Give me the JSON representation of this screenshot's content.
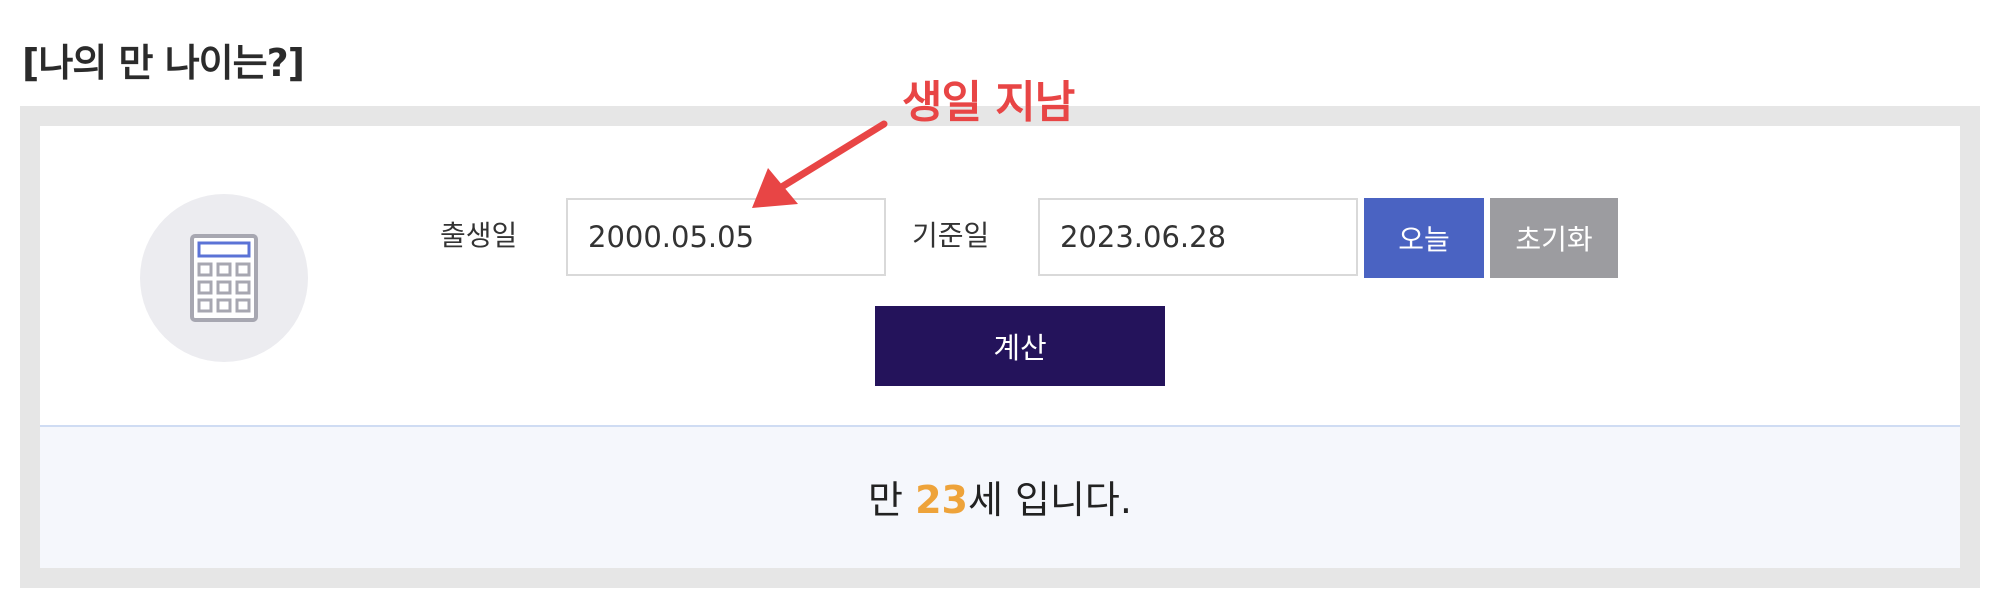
{
  "page": {
    "title": "[나의 만 나이는?]"
  },
  "form": {
    "birth_label": "출생일",
    "birth_value": "2000.05.05",
    "ref_label": "기준일",
    "ref_value": "2023.06.28",
    "today_button": "오늘",
    "reset_button": "초기화",
    "calc_button": "계산"
  },
  "result": {
    "prefix": "만 ",
    "age": "23",
    "suffix": "세 입니다."
  },
  "annotation": {
    "text": "생일 지남"
  },
  "colors": {
    "today_button": "#4a63c2",
    "reset_button": "#9c9ca0",
    "calc_button": "#24135b",
    "result_number": "#eea33a",
    "annotation": "#e84545"
  },
  "icons": {
    "calculator": "calculator-icon",
    "arrow": "arrow-icon"
  }
}
